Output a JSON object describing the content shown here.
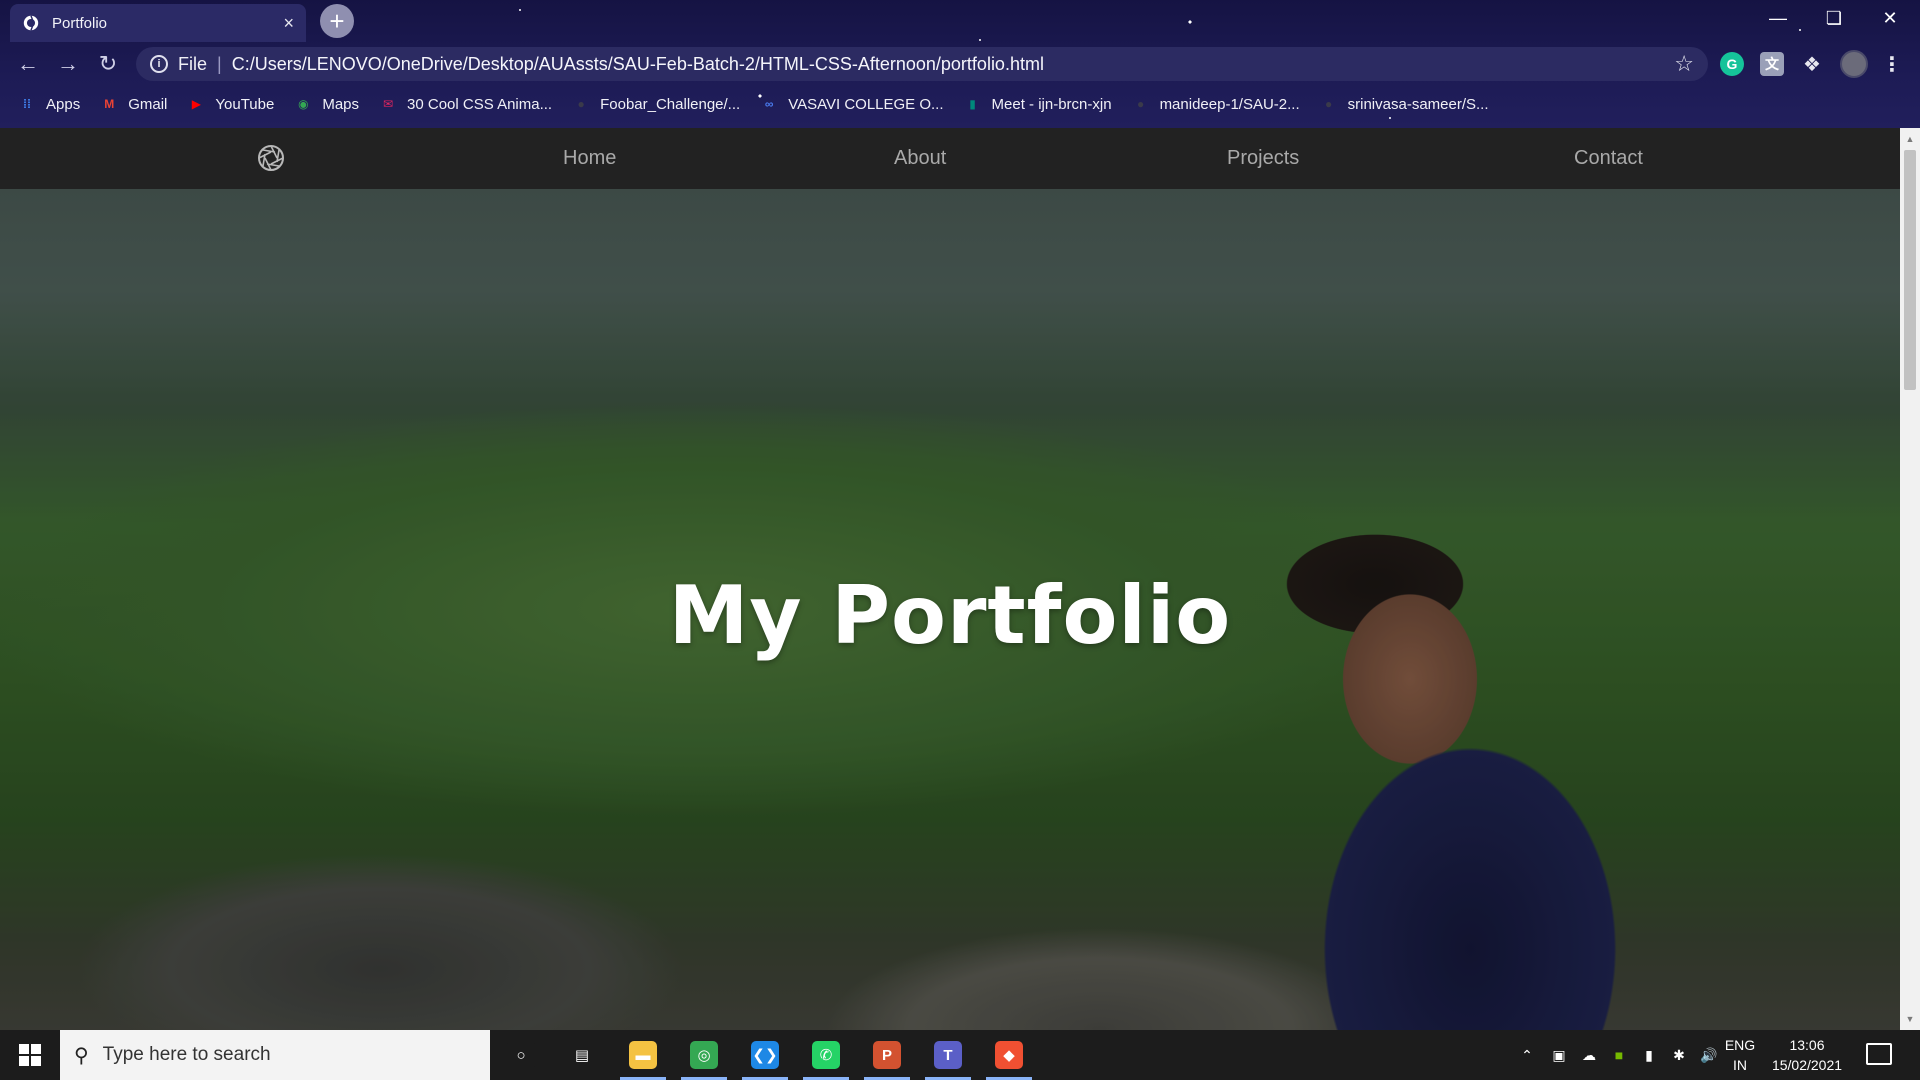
{
  "browser": {
    "tab_title": "Portfolio",
    "tab_close": "×",
    "new_tab": "+",
    "address_scheme": "File",
    "address_url": "C:/Users/LENOVO/OneDrive/Desktop/AUAssts/SAU-Feb-Batch-2/HTML-CSS-Afternoon/portfolio.html",
    "bookmarks": [
      {
        "label": "Apps",
        "icon": "apps-grid-icon",
        "color": "#4285f4"
      },
      {
        "label": "Gmail",
        "icon": "gmail-icon",
        "color": "#ea4335"
      },
      {
        "label": "YouTube",
        "icon": "youtube-icon",
        "color": "#ff0000"
      },
      {
        "label": "Maps",
        "icon": "maps-icon",
        "color": "#34a853"
      },
      {
        "label": "30 Cool CSS Anima...",
        "icon": "mail-icon",
        "color": "#e0245e"
      },
      {
        "label": "Foobar_Challenge/...",
        "icon": "github-icon",
        "color": "#3a3a4a"
      },
      {
        "label": "VASAVI COLLEGE O...",
        "icon": "infinity-icon",
        "color": "#4a7cf0"
      },
      {
        "label": "Meet - ijn-brcn-xjn",
        "icon": "meet-icon",
        "color": "#00897b"
      },
      {
        "label": "manideep-1/SAU-2...",
        "icon": "github-icon",
        "color": "#3a3a4a"
      },
      {
        "label": "srinivasa-sameer/S...",
        "icon": "github-icon",
        "color": "#3a3a4a"
      }
    ]
  },
  "site": {
    "nav": [
      {
        "label": "Home"
      },
      {
        "label": "About"
      },
      {
        "label": "Projects"
      },
      {
        "label": "Contact"
      }
    ],
    "hero_title": "My Portfolio"
  },
  "taskbar": {
    "search_placeholder": "Type here to search",
    "language_line1": "ENG",
    "language_line2": "IN",
    "time": "13:06",
    "date": "15/02/2021",
    "apps": [
      {
        "name": "cortana",
        "color": "#1c1c1c"
      },
      {
        "name": "task-view",
        "color": "#1c1c1c"
      },
      {
        "name": "file-explorer",
        "color": "#f4c242"
      },
      {
        "name": "chrome",
        "color": "#34a853"
      },
      {
        "name": "vscode",
        "color": "#1e88e5"
      },
      {
        "name": "whatsapp",
        "color": "#25d366"
      },
      {
        "name": "powerpoint",
        "color": "#d35230"
      },
      {
        "name": "teams",
        "color": "#5b5fc7"
      },
      {
        "name": "git",
        "color": "#f05032"
      }
    ]
  },
  "colors": {
    "chrome_bg": "#1d1b55",
    "site_nav_bg": "#222222",
    "site_nav_link": "#a9a9a9",
    "hero_title": "#ffffff"
  }
}
